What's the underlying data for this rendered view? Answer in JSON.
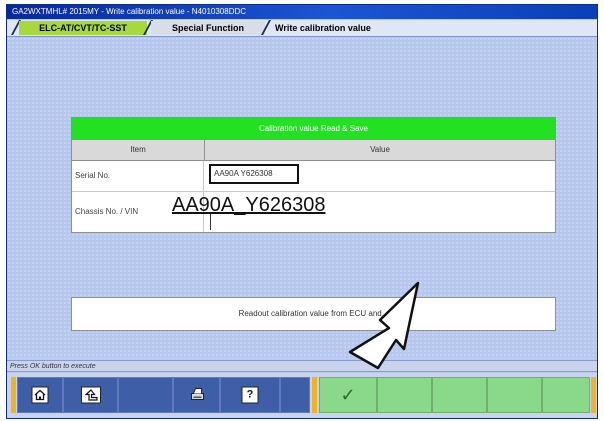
{
  "window": {
    "title": "GA2WXTMHL# 2015MY  -  Write calibration value  -  N4010308DDC"
  },
  "tabs": [
    {
      "label": "ELC-AT/CVT/TC-SST"
    },
    {
      "label": "Special Function"
    },
    {
      "label": "Write calibration value"
    }
  ],
  "table": {
    "title": "Calibration value Read & Save",
    "columns": {
      "item": "Item",
      "value": "Value"
    },
    "rows": [
      {
        "item": "Serial No.",
        "value": "AA90A Y626308"
      },
      {
        "item": "Chassis No. / VIN",
        "value": "AA90A_Y626308"
      }
    ]
  },
  "message": "Readout calibration value from ECU and...",
  "status_text": "Press OK button to execute",
  "toolbar": {
    "help_label": "?",
    "ok_label": "✓"
  },
  "colors": {
    "title_green": "#22e122",
    "tab_active": "#a7d93c",
    "function_key_blue": "#3f5ea8",
    "function_key_green": "#8ad88a",
    "accent_orange": "#f0b326"
  },
  "icons": [
    "home-icon",
    "back-icon",
    "print-icon",
    "help-icon",
    "checkmark-icon",
    "pointer-arrow-icon"
  ]
}
